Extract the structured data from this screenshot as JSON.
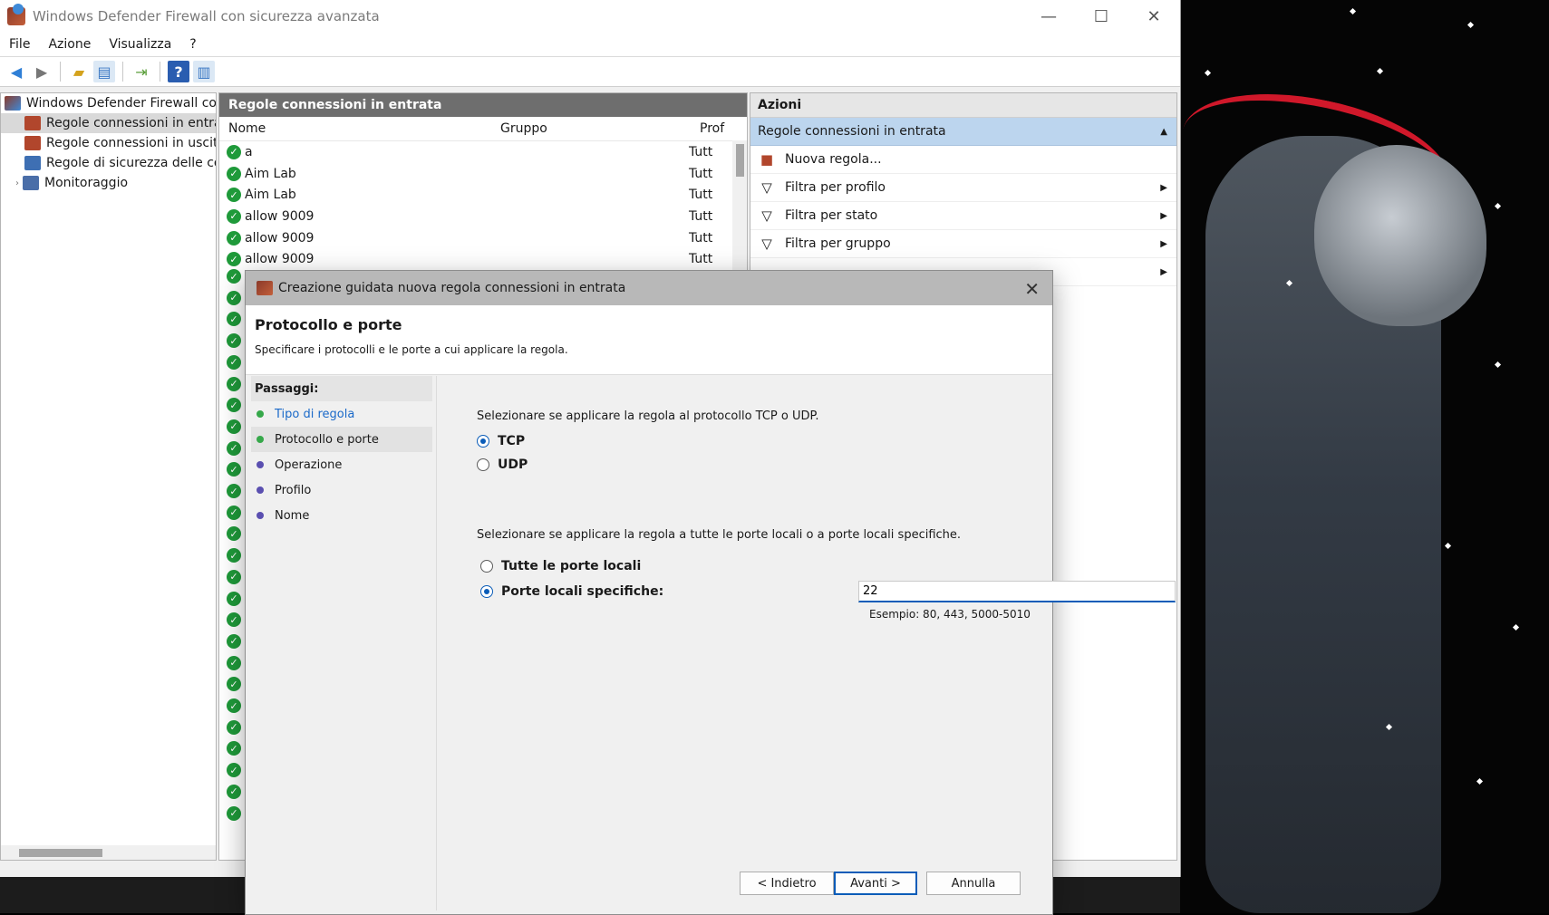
{
  "window": {
    "title": "Windows Defender Firewall con sicurezza avanzata",
    "minimize": "—",
    "maximize": "☐",
    "close": "✕"
  },
  "menu": [
    "File",
    "Azione",
    "Visualizza",
    "?"
  ],
  "toolbar": {
    "icons": [
      "back-icon",
      "forward-icon",
      "up-folder-icon",
      "show-hide-tree-icon",
      "export-list-icon",
      "help-icon",
      "show-hide-action-pane-icon"
    ]
  },
  "tree": {
    "root": "Windows Defender Firewall con",
    "items": [
      {
        "label": "Regole connessioni in entra",
        "selected": true,
        "icon": "inbound-rules-icon"
      },
      {
        "label": "Regole connessioni in uscita",
        "selected": false,
        "icon": "outbound-rules-icon"
      },
      {
        "label": "Regole di sicurezza delle cor",
        "selected": false,
        "icon": "connection-security-icon"
      },
      {
        "label": "Monitoraggio",
        "selected": false,
        "icon": "monitoring-icon"
      }
    ]
  },
  "rules_pane": {
    "title": "Regole connessioni in entrata",
    "columns": [
      "Nome",
      "Gruppo",
      "Prof"
    ],
    "rows": [
      {
        "name": "a",
        "group": "",
        "profile": "Tutt"
      },
      {
        "name": "Aim Lab",
        "group": "",
        "profile": "Tutt"
      },
      {
        "name": "Aim Lab",
        "group": "",
        "profile": "Tutt"
      },
      {
        "name": "allow 9009",
        "group": "",
        "profile": "Tutt"
      },
      {
        "name": "allow 9009",
        "group": "",
        "profile": "Tutt"
      },
      {
        "name": "allow 9009",
        "group": "",
        "profile": "Tutt"
      }
    ]
  },
  "actions": {
    "title": "Azioni",
    "section": "Regole connessioni in entrata",
    "items": [
      {
        "label": "Nuova regola...",
        "icon": "new-rule-icon",
        "submenu": false
      },
      {
        "label": "Filtra per profilo",
        "icon": "filter-icon",
        "submenu": true
      },
      {
        "label": "Filtra per stato",
        "icon": "filter-icon",
        "submenu": true
      },
      {
        "label": "Filtra per gruppo",
        "icon": "filter-icon",
        "submenu": true
      }
    ]
  },
  "wizard": {
    "title": "Creazione guidata nuova regola connessioni in entrata",
    "heading": "Protocollo e porte",
    "subheading": "Specificare i protocolli e le porte a cui applicare la regola.",
    "steps_title": "Passaggi:",
    "steps": [
      {
        "label": "Tipo di regola",
        "state": "done"
      },
      {
        "label": "Protocollo e porte",
        "state": "current"
      },
      {
        "label": "Operazione",
        "state": "pending"
      },
      {
        "label": "Profilo",
        "state": "pending"
      },
      {
        "label": "Nome",
        "state": "pending"
      }
    ],
    "protocol_prompt": "Selezionare se applicare la regola al protocollo TCP o UDP.",
    "tcp_label": "TCP",
    "udp_label": "UDP",
    "selected_protocol": "TCP",
    "ports_prompt": "Selezionare se applicare la regola a tutte le porte locali o a porte locali specifiche.",
    "all_ports_label": "Tutte le porte locali",
    "specific_ports_label": "Porte locali specifiche:",
    "selected_ports_option": "specific",
    "ports_value": "22",
    "ports_example": "Esempio: 80, 443, 5000-5010",
    "back_button": "< Indietro",
    "next_button": "Avanti >",
    "cancel_button": "Annulla"
  },
  "colors": {
    "accent": "#0a5cb8",
    "rule_enabled": "#1f9a3a",
    "action_section_bg": "#bcd5ee",
    "step_done": "#36a84a",
    "step_pending": "#5a4fb0"
  }
}
